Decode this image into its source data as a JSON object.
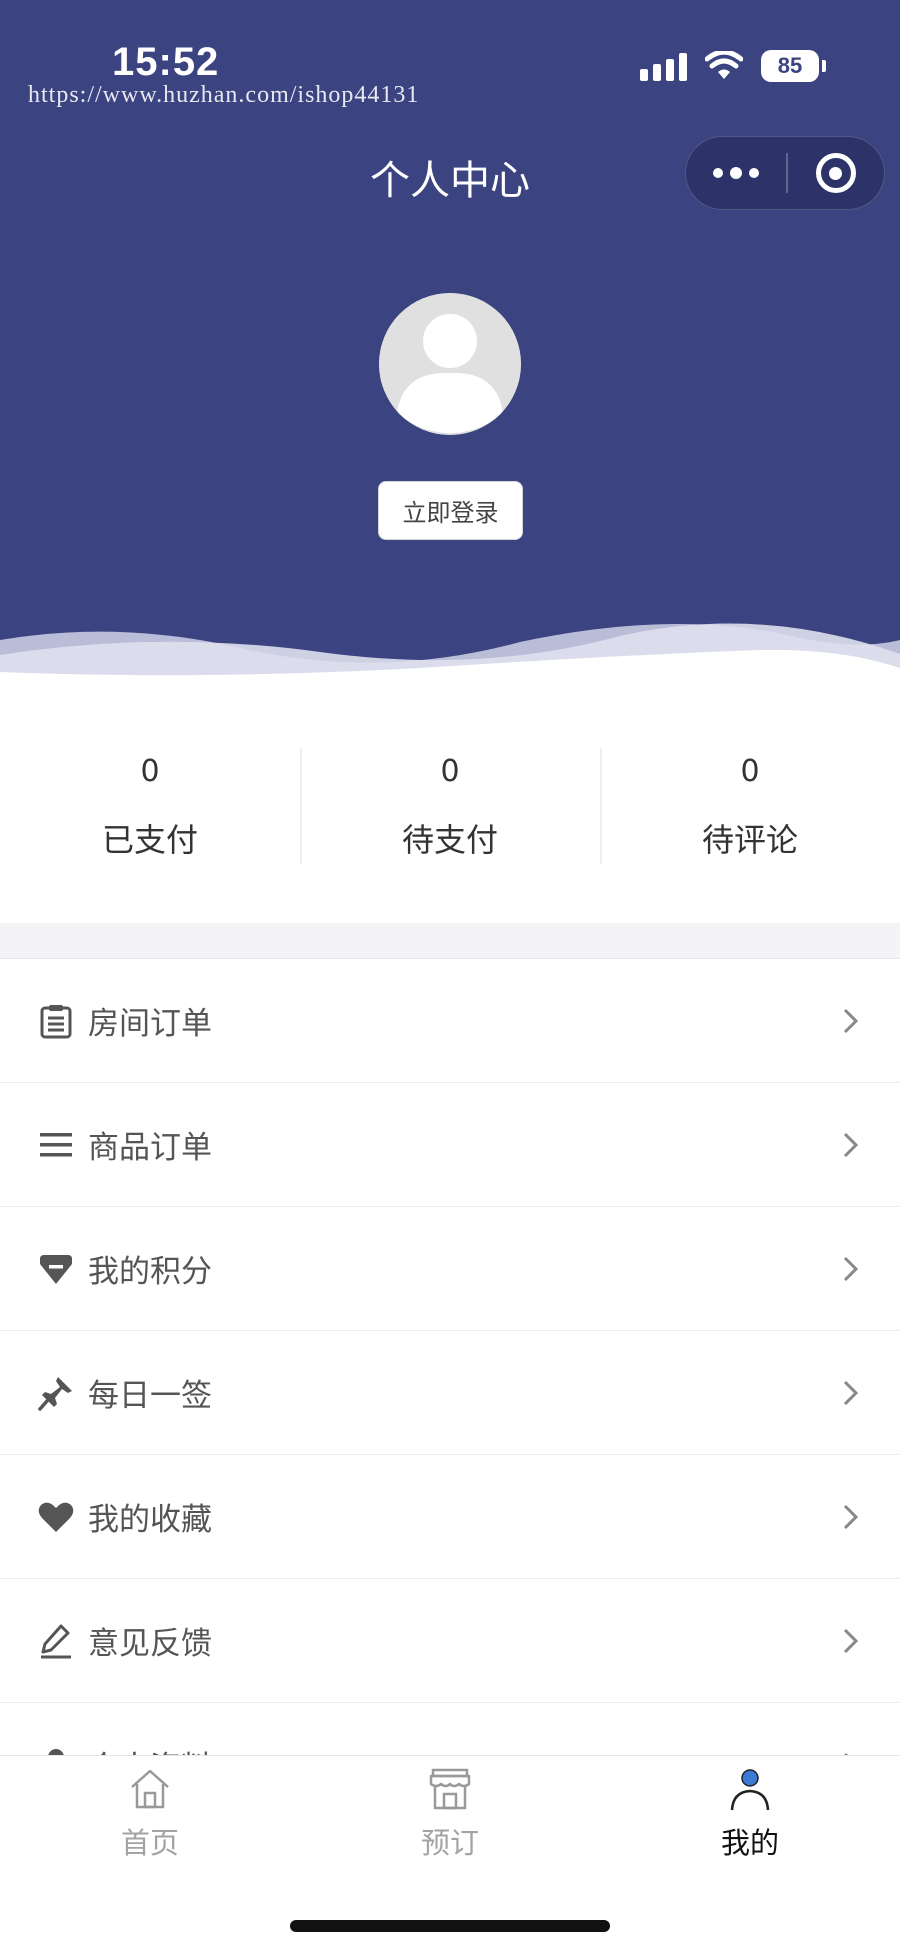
{
  "status_bar": {
    "time": "15:52",
    "battery": "85"
  },
  "watermark": "https://www.huzhan.com/ishop44131",
  "header": {
    "title": "个人中心"
  },
  "profile": {
    "login_button": "立即登录"
  },
  "stats": [
    {
      "value": "0",
      "label": "已支付"
    },
    {
      "value": "0",
      "label": "待支付"
    },
    {
      "value": "0",
      "label": "待评论"
    }
  ],
  "menu": [
    {
      "label": "房间订单",
      "icon": "clipboard-icon"
    },
    {
      "label": "商品订单",
      "icon": "list-icon"
    },
    {
      "label": "我的积分",
      "icon": "diamond-icon"
    },
    {
      "label": "每日一签",
      "icon": "pin-icon"
    },
    {
      "label": "我的收藏",
      "icon": "heart-icon"
    },
    {
      "label": "意见反馈",
      "icon": "pencil-icon"
    },
    {
      "label": "个人资料",
      "icon": "user-icon"
    }
  ],
  "tabbar": [
    {
      "label": "首页",
      "icon": "home-icon"
    },
    {
      "label": "预订",
      "icon": "store-icon"
    },
    {
      "label": "我的",
      "icon": "user-icon",
      "active": true
    }
  ],
  "colors": {
    "header_bg": "#3b4380",
    "accent": "#3a7bd5"
  }
}
